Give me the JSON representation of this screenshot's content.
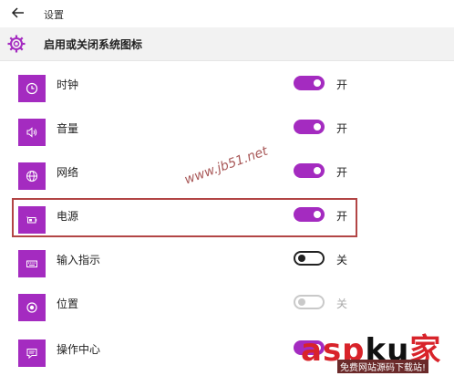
{
  "window": {
    "title": "设置"
  },
  "header": {
    "title": "启用或关闭系统图标"
  },
  "colors": {
    "accent": "#a42bc0",
    "highlight_border": "#b24545"
  },
  "items": [
    {
      "label": "时钟",
      "icon": "clock-icon",
      "state": "on",
      "state_label": "开"
    },
    {
      "label": "音量",
      "icon": "speaker-icon",
      "state": "on",
      "state_label": "开"
    },
    {
      "label": "网络",
      "icon": "globe-icon",
      "state": "on",
      "state_label": "开"
    },
    {
      "label": "电源",
      "icon": "battery-icon",
      "state": "on",
      "state_label": "开"
    },
    {
      "label": "输入指示",
      "icon": "keyboard-icon",
      "state": "off",
      "state_label": "关"
    },
    {
      "label": "位置",
      "icon": "location-icon",
      "state": "disabled",
      "state_label": "关"
    },
    {
      "label": "操作中心",
      "icon": "action-center-icon",
      "state": "on",
      "state_label": ""
    }
  ],
  "watermark": {
    "text": "www.jb51.net"
  },
  "logo": {
    "text": "asp ku 家",
    "subtitle": "免费网站源码下载站!"
  }
}
